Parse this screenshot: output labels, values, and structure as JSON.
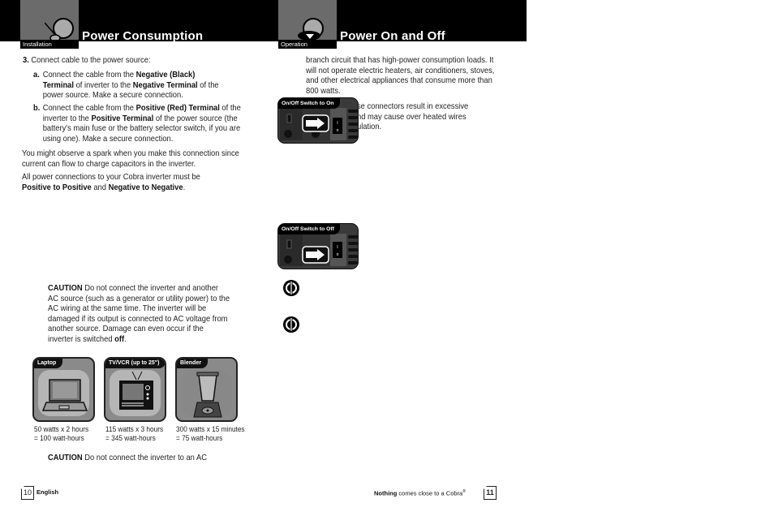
{
  "left_page": {
    "tab_label": "Installation",
    "title": "Power Consumption",
    "step": {
      "number": "3.",
      "text": "Connect cable to the power source:",
      "sub_a": {
        "letter": "a.",
        "pre": "Connect the cable from the ",
        "b1": "Negative (Black) Terminal",
        "mid": " of inverter to the ",
        "b2": "Negative Terminal",
        "post": " of the power source. Make a secure connection."
      },
      "sub_b": {
        "letter": "b.",
        "pre": "Connect the cable from the ",
        "b1": "Positive (Red) Terminal",
        "mid": " of the inverter to the ",
        "b2": "Positive Terminal",
        "post": " of the power source (the battery's main fuse or the battery selector switch, if you are using one). Make a secure connection."
      }
    },
    "para_spark": "You might observe a spark when you make this connection since current can flow to charge capacitors in the inverter.",
    "para_connections": {
      "pre": "All power connections to your Cobra inverter must be ",
      "b1": "Positive to Positive",
      "mid": " and ",
      "b2": "Negative to Negative",
      "post": "."
    },
    "caution1": {
      "label": "CAUTION",
      "text": " Do not connect the inverter and another AC source (such as a generator or utility power) to the AC wiring at the same time. The inverter will be damaged if its output is connected to AC voltage from another source. Damage can even occur if the inverter is switched ",
      "bold_end": "off",
      "end": "."
    },
    "appliances": [
      {
        "label": "Laptop",
        "line1": "50 watts x 2 hours",
        "line2": "= 100 watt-hours"
      },
      {
        "label": "TV/VCR (up to 25\")",
        "line1": "115 watts x 3 hours",
        "line2": "= 345 watt-hours"
      },
      {
        "label": "Blender",
        "line1": "300 watts x 15 minutes",
        "line2": "= 75 watt-hours"
      }
    ],
    "caution2": {
      "label": "CAUTION",
      "text": " Do not connect the inverter to an AC"
    },
    "footer": {
      "page": "10",
      "language": "English"
    }
  },
  "right_page": {
    "tab_label": "Operation",
    "title": "Power On and Off",
    "para_branch": "branch circuit that has high-power consumption loads. It will not operate electric heaters, air conditioners, stoves, and other electrical appliances that consume more than 800 watts.",
    "para_connectors": [
      "se connectors result in excessive",
      "nd may cause over heated wires",
      "ulation."
    ],
    "panel_on_label": "On/Off Switch to On",
    "panel_off_label": "On/Off Switch to Off",
    "footer": {
      "tagline_bold": "Nothing",
      "tagline": " comes close to a Cobra",
      "reg": "®",
      "page": "11"
    }
  }
}
